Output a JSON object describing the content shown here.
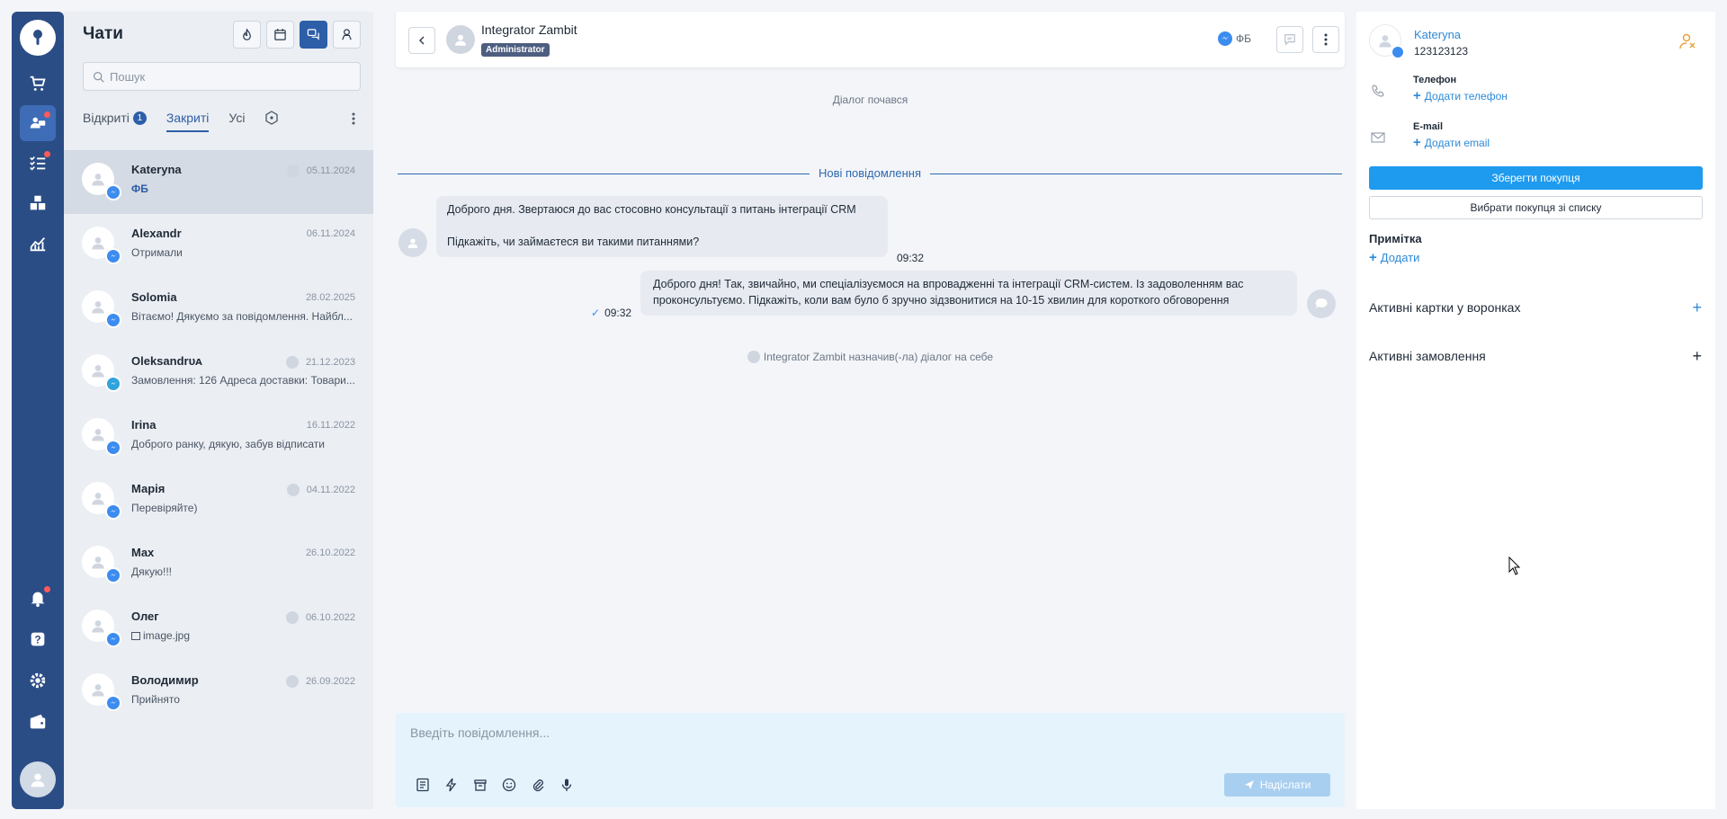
{
  "rail": {
    "items": [
      {
        "icon": "cart-icon"
      },
      {
        "icon": "chats-icon",
        "active": true,
        "dot": true
      },
      {
        "icon": "tasks-icon",
        "dot": true
      },
      {
        "icon": "boxes-icon"
      },
      {
        "icon": "analytics-icon"
      }
    ],
    "bottom": [
      {
        "icon": "bell-icon",
        "dot": true
      },
      {
        "icon": "help-icon"
      },
      {
        "icon": "gear-icon"
      },
      {
        "icon": "wallet-icon"
      }
    ]
  },
  "chats": {
    "title": "Чати",
    "search_placeholder": "Пошук",
    "tabs": [
      {
        "label": "Відкриті",
        "badge": "1"
      },
      {
        "label": "Закриті",
        "active": true
      },
      {
        "label": "Усі"
      }
    ],
    "items": [
      {
        "name": "Kateryna",
        "date": "05.11.2024",
        "preview": "ФБ",
        "channel": "messenger",
        "assigned": true,
        "selected": true,
        "tag": true
      },
      {
        "name": "Alexandr",
        "date": "06.11.2024",
        "preview": "Отримали",
        "channel": "messenger",
        "assigned": false
      },
      {
        "name": "Solomia",
        "date": "28.02.2025",
        "preview": "Вітаємо! Дякуємо за повідомлення. Найбл...",
        "channel": "messenger",
        "assigned": false
      },
      {
        "name": "Oleksandrᴜᴀ",
        "date": "21.12.2023",
        "preview": "Замовлення: 126 Адреса доставки: Товари...",
        "channel": "telegram",
        "assigned": true
      },
      {
        "name": "Irina",
        "date": "16.11.2022",
        "preview": "Доброго ранку, дякую, забув відписати",
        "channel": "messenger",
        "assigned": false
      },
      {
        "name": "Марія",
        "date": "04.11.2022",
        "preview": "Перевіряйте)",
        "channel": "messenger",
        "assigned": true
      },
      {
        "name": "Max",
        "date": "26.10.2022",
        "preview": "Дякую!!!",
        "channel": "messenger",
        "assigned": false
      },
      {
        "name": "Олег",
        "date": "06.10.2022",
        "preview": "image.jpg",
        "channel": "messenger",
        "assigned": true,
        "image": true
      },
      {
        "name": "Володимир",
        "date": "26.09.2022",
        "preview": "Прийнято",
        "channel": "messenger",
        "assigned": true
      }
    ]
  },
  "conversation": {
    "header": {
      "name": "Integrator Zambit",
      "role": "Administrator",
      "channel_label": "ФБ"
    },
    "started": "Діалог почався",
    "new_messages": "Нові повідомлення",
    "incoming": {
      "line1": "Доброго дня. Звертаюся до вас стосовно консультації з питань інтеграції CRM",
      "line2": "Підкажіть, чи займаєтеся ви такими питаннями?",
      "time": "09:32"
    },
    "outgoing": {
      "text": "Доброго дня! Так, звичайно, ми спеціалізуємося на впровадженні та інтеграції CRM-систем. Із задоволенням вас проконсультуємо. Підкажіть, коли вам було б зручно зідзвонитися на 10-15 хвилин для короткого обговорення",
      "time": "09:32"
    },
    "assigned_note": "Integrator Zambit назначив(-ла) діалог на себе",
    "composer_placeholder": "Введіть повідомлення...",
    "send_label": "Надіслати"
  },
  "customer": {
    "name": "Kateryna",
    "id": "123123123",
    "phone_label": "Телефон",
    "phone_add": "Додати телефон",
    "email_label": "E-mail",
    "email_add": "Додати email",
    "save_button": "Зберегти покупця",
    "choose_button": "Вибрати покупця зі списку",
    "note_title": "Примітка",
    "note_add": "Додати",
    "section_cards": "Активні картки у воронках",
    "section_orders": "Активні замовлення",
    "section_plus": "+"
  },
  "colors": {
    "rail": "#2b4d86",
    "accent": "#2d5ea8",
    "link": "#2d8ad8",
    "save": "#1e9bef",
    "composer": "#e4f3fc"
  }
}
